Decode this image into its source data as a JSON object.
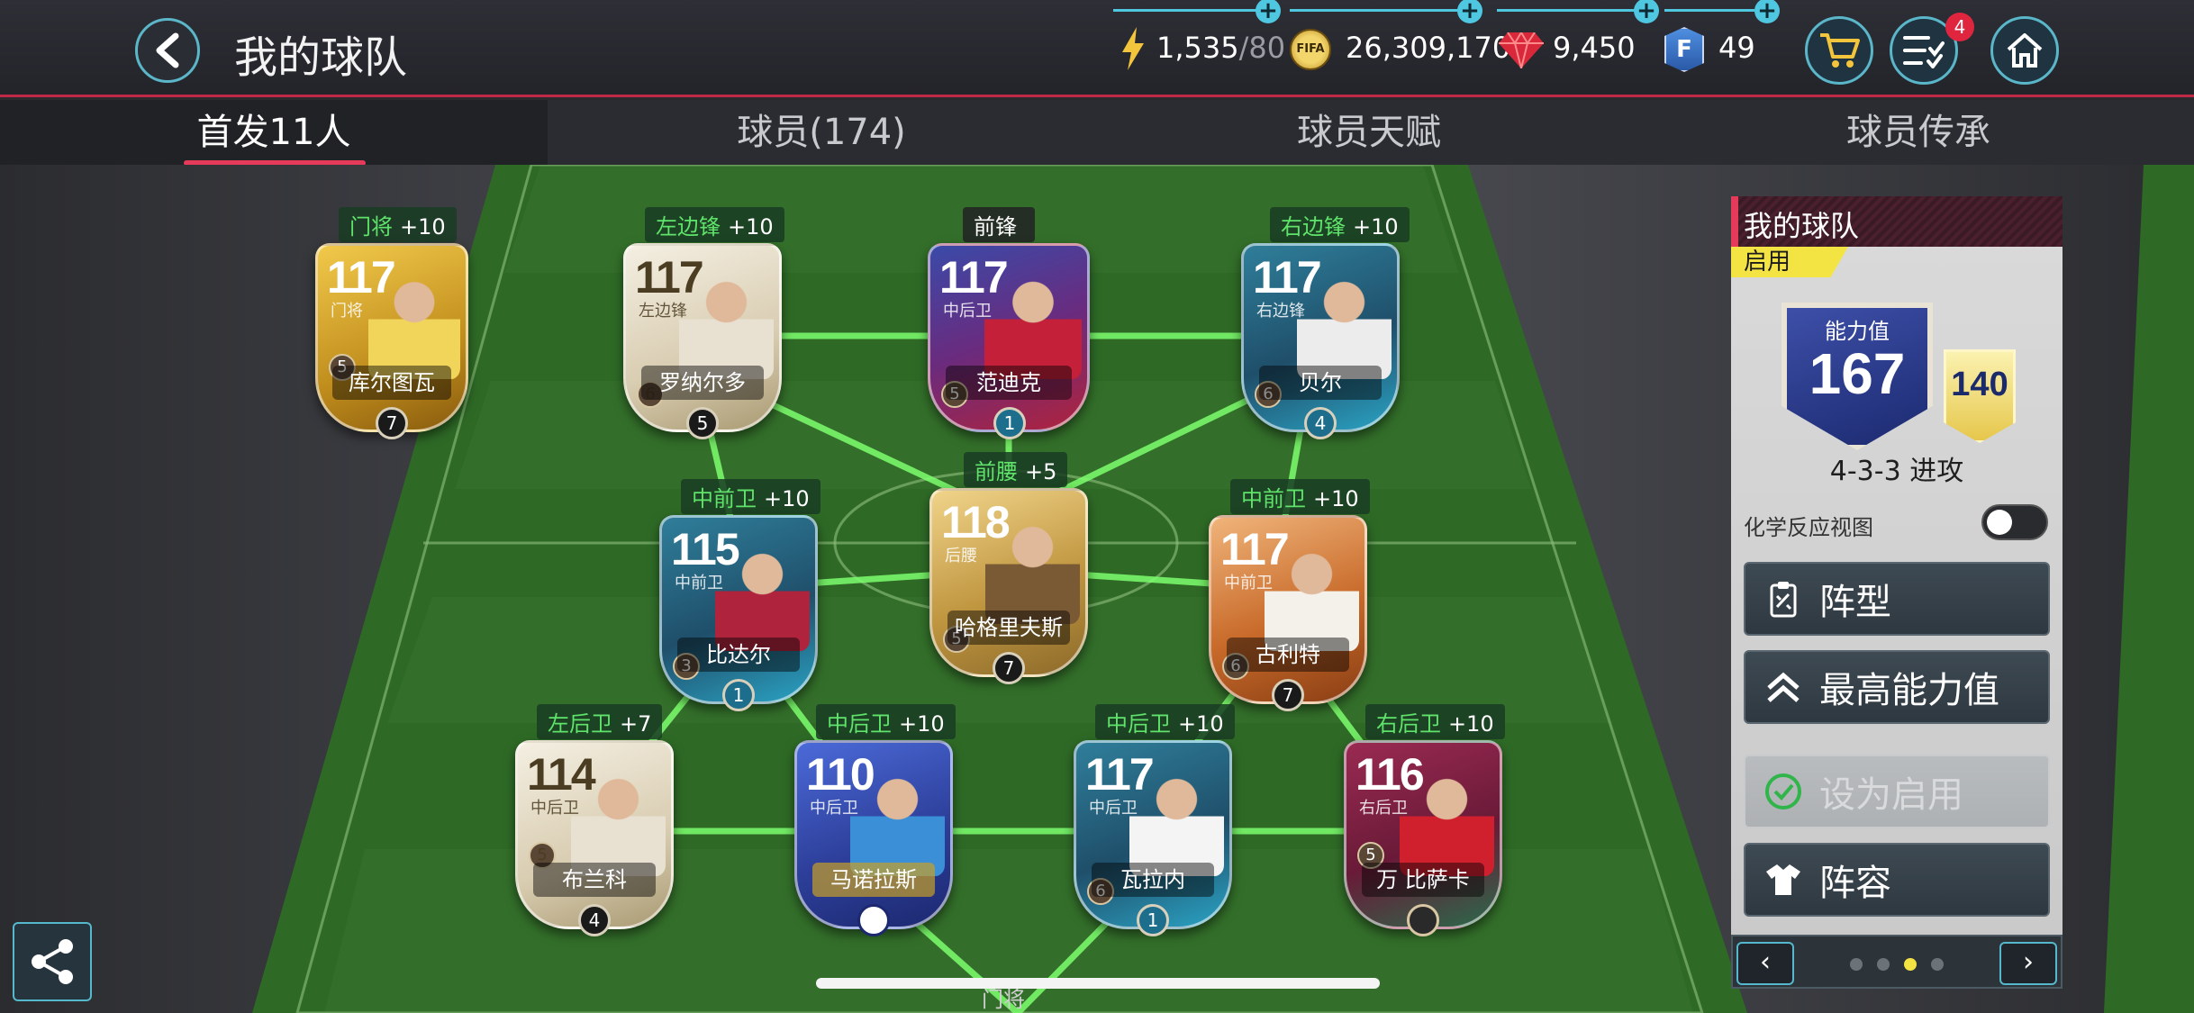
{
  "header": {
    "title": "我的球队",
    "resources": [
      {
        "icon": "energy-icon",
        "value": "1,535",
        "max": "/80"
      },
      {
        "icon": "fifa-coin-icon",
        "value": "26,309,170"
      },
      {
        "icon": "gem-icon",
        "value": "9,450"
      },
      {
        "icon": "fifa-points-icon",
        "value": "49"
      }
    ],
    "tasks_badge": "4",
    "fifa_coin_text": "FIFA",
    "fifa_points_text": "F"
  },
  "tabs": [
    "首发11人",
    "球员(174)",
    "球员天赋",
    "球员传承"
  ],
  "active_tab": 0,
  "players": [
    {
      "id": "gk",
      "position_label": "门将",
      "bonus": "+10",
      "rating": "117",
      "card_pos": "门将",
      "name": "库尔图瓦",
      "chem": "5",
      "rank": "7"
    },
    {
      "id": "lw",
      "position_label": "左边锋",
      "bonus": "+10",
      "rating": "117",
      "card_pos": "左边锋",
      "name": "罗纳尔多",
      "chem": "6",
      "rank": "5"
    },
    {
      "id": "st",
      "position_label": "前锋",
      "bonus": "",
      "rating": "117",
      "card_pos": "中后卫",
      "name": "范迪克",
      "chem": "5",
      "rank": "1"
    },
    {
      "id": "rw",
      "position_label": "右边锋",
      "bonus": "+10",
      "rating": "117",
      "card_pos": "右边锋",
      "name": "贝尔",
      "chem": "6",
      "rank": "4"
    },
    {
      "id": "lcm",
      "position_label": "中前卫",
      "bonus": "+10",
      "rating": "115",
      "card_pos": "中前卫",
      "name": "比达尔",
      "chem": "3",
      "rank": "1"
    },
    {
      "id": "cam",
      "position_label": "前腰",
      "bonus": "+5",
      "rating": "118",
      "card_pos": "后腰",
      "name": "哈格里夫斯",
      "chem": "5",
      "rank": "7"
    },
    {
      "id": "rcm",
      "position_label": "中前卫",
      "bonus": "+10",
      "rating": "117",
      "card_pos": "中前卫",
      "name": "古利特",
      "chem": "6",
      "rank": "7"
    },
    {
      "id": "lb",
      "position_label": "左后卫",
      "bonus": "+7",
      "rating": "114",
      "card_pos": "中后卫",
      "name": "布兰科",
      "chem": "5",
      "rank": "4"
    },
    {
      "id": "lcb",
      "position_label": "中后卫",
      "bonus": "+10",
      "rating": "110",
      "card_pos": "中后卫",
      "name": "马诺拉斯",
      "chem": "",
      "rank": ""
    },
    {
      "id": "rcb",
      "position_label": "中后卫",
      "bonus": "+10",
      "rating": "117",
      "card_pos": "中后卫",
      "name": "瓦拉内",
      "chem": "6",
      "rank": "1"
    },
    {
      "id": "rb",
      "position_label": "右后卫",
      "bonus": "+10",
      "rating": "116",
      "card_pos": "右后卫",
      "name": "万 比萨卡",
      "chem": "5",
      "rank": ""
    }
  ],
  "panel": {
    "title": "我的球队",
    "active_tag": "启用",
    "power_label": "能力值",
    "power_value": "167",
    "secondary_value": "140",
    "formation": "4-3-3 进攻",
    "chem_view_label": "化学反应视图",
    "chem_view_on": false,
    "buttons": {
      "formation": "阵型",
      "best": "最高能力值",
      "set_active": "设为启用",
      "lineup": "阵容"
    },
    "pager": {
      "prev": "‹",
      "next": "›",
      "pages": 4,
      "current": 2
    }
  },
  "footer": {
    "gk_label": "门将"
  },
  "colors": {
    "accent": "#e63a5a",
    "chem_line": "#7dff6e",
    "cyan": "#4fc7e0",
    "tag_yellow": "#f4e443"
  }
}
